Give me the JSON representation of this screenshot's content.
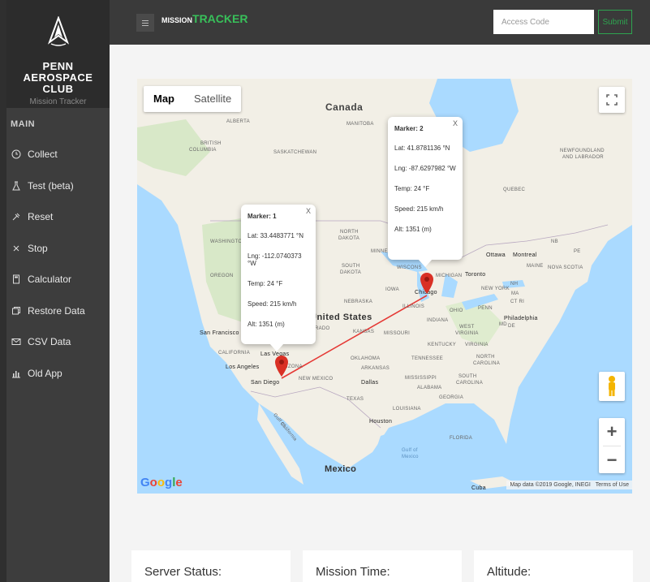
{
  "sidebar": {
    "club_name_line1": "PENN AEROSPACE",
    "club_name_line2": "CLUB",
    "subtitle": "Mission Tracker",
    "section_label": "MAIN",
    "items": [
      {
        "label": "Collect",
        "icon": "clock-icon"
      },
      {
        "label": "Test (beta)",
        "icon": "flask-icon"
      },
      {
        "label": "Reset",
        "icon": "reset-icon"
      },
      {
        "label": "Stop",
        "icon": "close-icon"
      },
      {
        "label": "Calculator",
        "icon": "calculator-icon"
      },
      {
        "label": "Restore Data",
        "icon": "restore-icon"
      },
      {
        "label": "CSV Data",
        "icon": "mail-icon"
      },
      {
        "label": "Old App",
        "icon": "bar-chart-icon"
      }
    ]
  },
  "topbar": {
    "brand_prefix": "MISSION",
    "brand_suffix": "TRACKER",
    "access_placeholder": "Access Code",
    "submit_label": "Submit",
    "accent_color": "#38c05a"
  },
  "map": {
    "type_map": "Map",
    "type_satellite": "Satellite",
    "google_logo": "Google",
    "attribution": "Map data ©2019 Google, INEGI",
    "terms": "Terms of Use",
    "zoom_in": "+",
    "zoom_out": "−",
    "labels": {
      "canada": "Canada",
      "united_states": "United States",
      "mexico": "Mexico",
      "alberta": "ALBERTA",
      "manitoba": "MANITOBA",
      "british_columbia_1": "BRITISH",
      "british_columbia_2": "COLUMBIA",
      "saskatchewan": "SASKATCHEWAN",
      "newfoundland_1": "NEWFOUNDLAND",
      "newfoundland_2": "AND LABRADOR",
      "quebec": "QUEBEC",
      "washington": "WASHINGTON",
      "north_dakota_1": "NORTH",
      "north_dakota_2": "DAKOTA",
      "minnesota": "MINNES",
      "wisconsin": "WISCONS",
      "michigan": "MICHIGAN",
      "ottawa": "Ottawa",
      "montreal": "Montreal",
      "toronto": "Toronto",
      "nb": "NB",
      "pe": "PE",
      "maine": "MAINE",
      "nova_scotia": "NOVA SCOTIA",
      "oregon": "OREGON",
      "south_dakota_1": "SOUTH",
      "south_dakota_2": "DAKOTA",
      "iowa": "IOWA",
      "chicago": "Chicago",
      "new_york": "NEW YORK",
      "nh": "NH",
      "ma": "MA",
      "ct_ri": "CT RI",
      "nebraska": "NEBRASKA",
      "illinois": "ILLINOIS",
      "ohio": "OHIO",
      "penn": "PENN",
      "philadelphia": "Philadelphia",
      "md": "MD",
      "de": "DE",
      "indiana": "INDIANA",
      "san_francisco": "San Francisco",
      "colorado": "ORADO",
      "kansas": "KANSAS",
      "missouri": "MISSOURI",
      "west_virginia_1": "WEST",
      "west_virginia_2": "VIRGINIA",
      "virginia": "VIRGINIA",
      "kentucky": "KENTUCKY",
      "california": "CALIFORNIA",
      "las_vegas": "Las Vegas",
      "tennessee": "TENNESSEE",
      "north_carolina_1": "NORTH",
      "north_carolina_2": "CAROLINA",
      "oklahoma": "OKLAHOMA",
      "los_angeles": "Los Angeles",
      "arizona": "ARIZONA",
      "arkansas": "ARKANSAS",
      "san_diego": "San Diego",
      "new_mexico": "NEW MEXICO",
      "dallas": "Dallas",
      "mississippi": "MISSISSIPPI",
      "south_carolina_1": "SOUTH",
      "south_carolina_2": "CAROLINA",
      "alabama": "ALABAMA",
      "georgia": "GEORGIA",
      "texas": "TEXAS",
      "louisiana": "LOUISIANA",
      "houston": "Houston",
      "florida": "FLORIDA",
      "gulf_california_1": "Gulf of",
      "gulf_california_2": "California",
      "gulf_mexico_1": "Gulf of",
      "gulf_mexico_2": "Mexico",
      "cuba": "Cuba"
    },
    "markers": [
      {
        "title": "Marker: 1",
        "lat": "Lat: 33.4483771 °N",
        "lng": "Lng: -112.0740373 °W",
        "temp": "Temp: 24 °F",
        "speed": "Speed: 215 km/h",
        "alt": "Alt: 1351 (m)",
        "close": "X"
      },
      {
        "title": "Marker: 2",
        "lat": "Lat: 41.8781136 °N",
        "lng": "Lng: -87.6297982 °W",
        "temp": "Temp: 24 °F",
        "speed": "Speed: 215 km/h",
        "alt": "Alt: 1351 (m)",
        "close": "X"
      }
    ],
    "path_color": "#e53935",
    "marker_color": "#d93025"
  },
  "cards": [
    {
      "label": "Server Status:"
    },
    {
      "label": "Mission Time:"
    },
    {
      "label": "Altitude:"
    }
  ]
}
